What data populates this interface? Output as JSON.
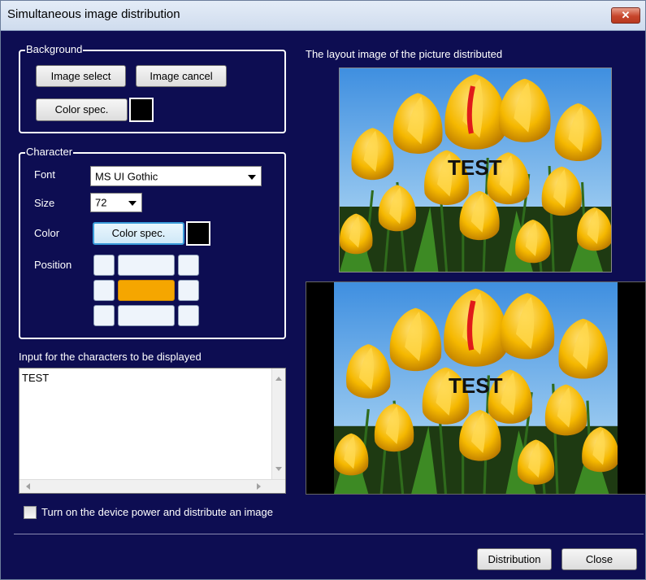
{
  "window": {
    "title": "Simultaneous image distribution",
    "close_glyph": "✕"
  },
  "background_group": {
    "legend": "Background",
    "image_select": "Image select",
    "image_cancel": "Image cancel",
    "color_spec": "Color spec.",
    "swatch_color": "#000000"
  },
  "character_group": {
    "legend": "Character",
    "font_label": "Font",
    "font_value": "MS UI Gothic",
    "size_label": "Size",
    "size_value": "72",
    "color_label": "Color",
    "color_spec": "Color spec.",
    "swatch_color": "#000000",
    "position_label": "Position",
    "position_selected": "middle-center"
  },
  "input": {
    "label": "Input for the characters to be displayed",
    "value": "TEST"
  },
  "preview": {
    "label": "The layout image of the picture distributed",
    "overlay_text": "TEST"
  },
  "checkbox": {
    "label": "Turn on the device power and distribute an image",
    "checked": false
  },
  "footer": {
    "distribution": "Distribution",
    "close": "Close"
  },
  "colors": {
    "window_bg": "#0d0d52",
    "accent": "#f5a600"
  }
}
